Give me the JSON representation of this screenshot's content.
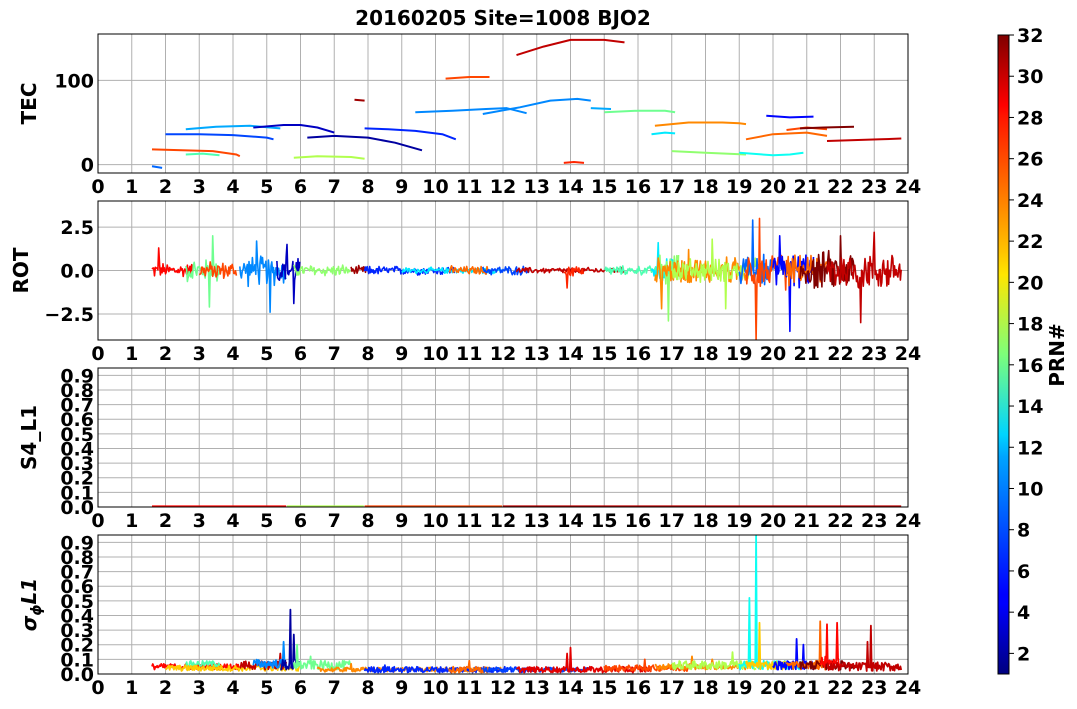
{
  "title": "20160205 Site=1008 BJO2",
  "colorbar": {
    "label": "PRN#",
    "range": [
      1,
      32
    ],
    "ticks": [
      2,
      4,
      6,
      8,
      10,
      12,
      14,
      16,
      18,
      20,
      22,
      24,
      26,
      28,
      30,
      32
    ],
    "colormap": "jet"
  },
  "chart_data": [
    {
      "type": "line",
      "panel": "TEC",
      "ylabel": "TEC",
      "xlim": [
        0,
        24
      ],
      "ylim": [
        -10,
        155
      ],
      "xticks": [
        0,
        1,
        2,
        3,
        4,
        5,
        6,
        7,
        8,
        9,
        10,
        11,
        12,
        13,
        14,
        15,
        16,
        17,
        18,
        19,
        20,
        21,
        22,
        23,
        24
      ],
      "yticks": [
        0,
        100
      ],
      "grid": true,
      "series": [
        {
          "prn": 26,
          "x": [
            1.6,
            2.5,
            3.4,
            4.1,
            4.2
          ],
          "y": [
            18,
            17,
            16,
            12,
            10
          ]
        },
        {
          "prn": 8,
          "x": [
            1.6,
            1.9
          ],
          "y": [
            -2,
            -4
          ]
        },
        {
          "prn": 15,
          "x": [
            2.6,
            3.1,
            3.6
          ],
          "y": [
            12,
            13,
            11
          ]
        },
        {
          "prn": 7,
          "x": [
            2.0,
            3.0,
            4.0,
            5.0,
            5.2
          ],
          "y": [
            36,
            36,
            35,
            32,
            30
          ]
        },
        {
          "prn": 10,
          "x": [
            2.6,
            3.5,
            4.5,
            5.4
          ],
          "y": [
            42,
            45,
            46,
            43
          ]
        },
        {
          "prn": 3,
          "x": [
            4.6,
            5.5,
            6.0,
            6.5,
            7.0
          ],
          "y": [
            44,
            47,
            47,
            44,
            38
          ]
        },
        {
          "prn": 18,
          "x": [
            5.8,
            6.5,
            7.5,
            7.9
          ],
          "y": [
            8,
            10,
            9,
            7
          ]
        },
        {
          "prn": 2,
          "x": [
            6.2,
            7.0,
            8.0,
            8.8,
            9.6
          ],
          "y": [
            32,
            34,
            32,
            26,
            17
          ]
        },
        {
          "prn": 31,
          "x": [
            7.6,
            7.9
          ],
          "y": [
            77,
            76
          ]
        },
        {
          "prn": 6,
          "x": [
            7.9,
            8.6,
            9.4,
            10.2,
            10.6
          ],
          "y": [
            43,
            42,
            40,
            36,
            30
          ]
        },
        {
          "prn": 9,
          "x": [
            9.4,
            10.5,
            11.5,
            12.1,
            12.7
          ],
          "y": [
            62,
            64,
            66,
            67,
            61
          ]
        },
        {
          "prn": 26,
          "x": [
            10.3,
            11.0,
            11.6
          ],
          "y": [
            102,
            104,
            104
          ]
        },
        {
          "prn": 9,
          "x": [
            11.4,
            12.5,
            13.4,
            14.2,
            14.6
          ],
          "y": [
            60,
            68,
            76,
            78,
            76
          ]
        },
        {
          "prn": 30,
          "x": [
            12.4,
            13.2,
            14.0,
            15.0,
            15.6
          ],
          "y": [
            130,
            140,
            148,
            148,
            145
          ]
        },
        {
          "prn": 27,
          "x": [
            13.8,
            14.1,
            14.4
          ],
          "y": [
            2,
            3,
            2
          ]
        },
        {
          "prn": 10,
          "x": [
            14.6,
            15.2
          ],
          "y": [
            67,
            66
          ]
        },
        {
          "prn": 16,
          "x": [
            15.0,
            16.0,
            16.8,
            17.1
          ],
          "y": [
            62,
            64,
            64,
            62
          ]
        },
        {
          "prn": 12,
          "x": [
            16.4,
            16.8,
            17.1
          ],
          "y": [
            36,
            38,
            37
          ]
        },
        {
          "prn": 24,
          "x": [
            16.5,
            17.5,
            18.5,
            19.0,
            19.2
          ],
          "y": [
            46,
            50,
            50,
            49,
            48
          ]
        },
        {
          "prn": 17,
          "x": [
            17.0,
            18.0,
            19.2
          ],
          "y": [
            16,
            14,
            12
          ]
        },
        {
          "prn": 13,
          "x": [
            19.0,
            20.0,
            20.5,
            20.9
          ],
          "y": [
            14,
            11,
            12,
            14
          ]
        },
        {
          "prn": 25,
          "x": [
            19.2,
            20.0,
            21.0,
            21.6
          ],
          "y": [
            30,
            36,
            38,
            34
          ]
        },
        {
          "prn": 5,
          "x": [
            19.8,
            20.5,
            21.2
          ],
          "y": [
            58,
            56,
            57
          ]
        },
        {
          "prn": 26,
          "x": [
            20.4,
            21.0,
            21.6
          ],
          "y": [
            41,
            44,
            42
          ]
        },
        {
          "prn": 32,
          "x": [
            20.8,
            21.5,
            22.4
          ],
          "y": [
            43,
            44,
            45
          ]
        },
        {
          "prn": 30,
          "x": [
            21.6,
            22.4,
            23.2,
            23.8
          ],
          "y": [
            28,
            29,
            30,
            31
          ]
        }
      ]
    },
    {
      "type": "line",
      "panel": "ROT",
      "ylabel": "ROT",
      "xlim": [
        0,
        24
      ],
      "ylim": [
        -4,
        4
      ],
      "xticks": [
        0,
        1,
        2,
        3,
        4,
        5,
        6,
        7,
        8,
        9,
        10,
        11,
        12,
        13,
        14,
        15,
        16,
        17,
        18,
        19,
        20,
        21,
        22,
        23,
        24
      ],
      "yticks": [
        -2.5,
        0.0,
        2.5
      ],
      "yticklabels": [
        "−2.5",
        "0.0",
        "2.5"
      ],
      "grid": true,
      "segments": [
        {
          "prn": 28,
          "x0": 1.6,
          "x1": 2.8,
          "amp": 0.5,
          "spikes": [
            [
              1.8,
              1.3
            ]
          ]
        },
        {
          "prn": 16,
          "x0": 2.6,
          "x1": 3.6,
          "amp": 0.8,
          "spikes": [
            [
              3.3,
              -2.1
            ],
            [
              3.4,
              2.0
            ]
          ]
        },
        {
          "prn": 26,
          "x0": 3.0,
          "x1": 4.1,
          "amp": 0.6,
          "spikes": []
        },
        {
          "prn": 9,
          "x0": 4.2,
          "x1": 5.6,
          "amp": 1.0,
          "spikes": [
            [
              5.1,
              -2.4
            ],
            [
              4.7,
              1.7
            ]
          ]
        },
        {
          "prn": 3,
          "x0": 5.3,
          "x1": 6.0,
          "amp": 1.1,
          "spikes": [
            [
              5.6,
              1.5
            ],
            [
              5.8,
              -1.9
            ]
          ]
        },
        {
          "prn": 17,
          "x0": 5.8,
          "x1": 7.5,
          "amp": 0.4,
          "spikes": []
        },
        {
          "prn": 31,
          "x0": 7.5,
          "x1": 8.0,
          "amp": 0.3,
          "spikes": []
        },
        {
          "prn": 6,
          "x0": 7.9,
          "x1": 10.6,
          "amp": 0.3,
          "spikes": []
        },
        {
          "prn": 12,
          "x0": 9.0,
          "x1": 12.0,
          "amp": 0.2,
          "spikes": []
        },
        {
          "prn": 25,
          "x0": 10.4,
          "x1": 11.6,
          "amp": 0.3,
          "spikes": []
        },
        {
          "prn": 7,
          "x0": 11.4,
          "x1": 12.8,
          "amp": 0.3,
          "spikes": []
        },
        {
          "prn": 30,
          "x0": 12.4,
          "x1": 15.6,
          "amp": 0.2,
          "spikes": []
        },
        {
          "prn": 27,
          "x0": 13.8,
          "x1": 14.4,
          "amp": 0.4,
          "spikes": [
            [
              13.9,
              -1.0
            ]
          ]
        },
        {
          "prn": 15,
          "x0": 15.0,
          "x1": 17.1,
          "amp": 0.3,
          "spikes": []
        },
        {
          "prn": 12,
          "x0": 16.4,
          "x1": 17.1,
          "amp": 0.8,
          "spikes": [
            [
              16.6,
              1.6
            ]
          ]
        },
        {
          "prn": 17,
          "x0": 16.6,
          "x1": 17.2,
          "amp": 1.2,
          "spikes": [
            [
              16.9,
              3.5
            ],
            [
              16.9,
              -2.9
            ]
          ]
        },
        {
          "prn": 24,
          "x0": 16.5,
          "x1": 19.2,
          "amp": 0.9,
          "spikes": [
            [
              16.7,
              -2.2
            ],
            [
              17.5,
              1.2
            ]
          ]
        },
        {
          "prn": 18,
          "x0": 17.0,
          "x1": 19.5,
          "amp": 0.8,
          "spikes": [
            [
              18.2,
              1.8
            ],
            [
              18.6,
              -2.2
            ]
          ]
        },
        {
          "prn": 8,
          "x0": 19.0,
          "x1": 20.0,
          "amp": 1.0,
          "spikes": [
            [
              19.4,
              2.9
            ]
          ]
        },
        {
          "prn": 26,
          "x0": 19.2,
          "x1": 20.4,
          "amp": 1.3,
          "spikes": [
            [
              19.5,
              -4.0
            ],
            [
              19.6,
              3.0
            ]
          ]
        },
        {
          "prn": 5,
          "x0": 20.0,
          "x1": 21.2,
          "amp": 1.2,
          "spikes": [
            [
              20.2,
              2.0
            ],
            [
              20.5,
              -3.5
            ]
          ]
        },
        {
          "prn": 25,
          "x0": 20.4,
          "x1": 21.6,
          "amp": 1.0,
          "spikes": []
        },
        {
          "prn": 32,
          "x0": 20.8,
          "x1": 22.4,
          "amp": 1.3,
          "spikes": [
            [
              22.0,
              2.0
            ]
          ]
        },
        {
          "prn": 30,
          "x0": 21.6,
          "x1": 23.8,
          "amp": 1.4,
          "spikes": [
            [
              22.6,
              -3.0
            ],
            [
              23.0,
              2.2
            ]
          ]
        }
      ]
    },
    {
      "type": "line",
      "panel": "S4_L1",
      "ylabel": "S4_L1",
      "xlim": [
        0,
        24
      ],
      "ylim": [
        0,
        0.95
      ],
      "xticks": [
        0,
        1,
        2,
        3,
        4,
        5,
        6,
        7,
        8,
        9,
        10,
        11,
        12,
        13,
        14,
        15,
        16,
        17,
        18,
        19,
        20,
        21,
        22,
        23,
        24
      ],
      "yticks": [
        0.0,
        0.1,
        0.2,
        0.3,
        0.4,
        0.5,
        0.6,
        0.7,
        0.8,
        0.9
      ],
      "grid": true,
      "segments": [
        {
          "prn": 28,
          "x0": 1.6,
          "x1": 5.6,
          "level": 0.005
        },
        {
          "prn": 18,
          "x0": 5.6,
          "x1": 7.9,
          "level": 0.005
        },
        {
          "prn": 26,
          "x0": 7.9,
          "x1": 12.0,
          "level": 0.005
        },
        {
          "prn": 30,
          "x0": 12.0,
          "x1": 23.8,
          "level": 0.005
        }
      ]
    },
    {
      "type": "line",
      "panel": "sigma_phi_L1",
      "ylabel": "σϕL1",
      "xlim": [
        0,
        24
      ],
      "ylim": [
        0,
        0.95
      ],
      "xticks": [
        0,
        1,
        2,
        3,
        4,
        5,
        6,
        7,
        8,
        9,
        10,
        11,
        12,
        13,
        14,
        15,
        16,
        17,
        18,
        19,
        20,
        21,
        22,
        23,
        24
      ],
      "yticks": [
        0.0,
        0.1,
        0.2,
        0.3,
        0.4,
        0.5,
        0.6,
        0.7,
        0.8,
        0.9
      ],
      "grid": true,
      "segments": [
        {
          "prn": 28,
          "x0": 1.6,
          "x1": 4.2,
          "base": 0.05,
          "amp": 0.02,
          "spikes": []
        },
        {
          "prn": 15,
          "x0": 2.6,
          "x1": 3.6,
          "base": 0.07,
          "amp": 0.02,
          "spikes": []
        },
        {
          "prn": 22,
          "x0": 2.0,
          "x1": 6.0,
          "base": 0.04,
          "amp": 0.02,
          "spikes": []
        },
        {
          "prn": 30,
          "x0": 4.2,
          "x1": 5.6,
          "base": 0.06,
          "amp": 0.03,
          "spikes": [
            [
              5.4,
              0.14
            ]
          ]
        },
        {
          "prn": 9,
          "x0": 4.6,
          "x1": 5.6,
          "base": 0.07,
          "amp": 0.03,
          "spikes": [
            [
              5.5,
              0.22
            ]
          ]
        },
        {
          "prn": 2,
          "x0": 5.4,
          "x1": 6.0,
          "base": 0.06,
          "amp": 0.04,
          "spikes": [
            [
              5.7,
              0.44
            ],
            [
              5.8,
              0.27
            ]
          ]
        },
        {
          "prn": 16,
          "x0": 5.8,
          "x1": 7.5,
          "base": 0.06,
          "amp": 0.03,
          "spikes": [
            [
              5.9,
              0.2
            ],
            [
              6.3,
              0.12
            ]
          ]
        },
        {
          "prn": 24,
          "x0": 6.5,
          "x1": 12.0,
          "base": 0.03,
          "amp": 0.015,
          "spikes": [
            [
              7.5,
              0.07
            ]
          ]
        },
        {
          "prn": 6,
          "x0": 7.9,
          "x1": 12.8,
          "base": 0.03,
          "amp": 0.02,
          "spikes": [
            [
              8.5,
              0.06
            ]
          ]
        },
        {
          "prn": 25,
          "x0": 10.4,
          "x1": 11.6,
          "base": 0.03,
          "amp": 0.02,
          "spikes": [
            [
              11.0,
              0.09
            ]
          ]
        },
        {
          "prn": 7,
          "x0": 11.4,
          "x1": 14.6,
          "base": 0.03,
          "amp": 0.015,
          "spikes": []
        },
        {
          "prn": 29,
          "x0": 12.4,
          "x1": 16.4,
          "base": 0.03,
          "amp": 0.02,
          "spikes": [
            [
              14.0,
              0.18
            ],
            [
              13.9,
              0.14
            ]
          ]
        },
        {
          "prn": 26,
          "x0": 15.0,
          "x1": 17.5,
          "base": 0.04,
          "amp": 0.02,
          "spikes": [
            [
              16.2,
              0.1
            ]
          ]
        },
        {
          "prn": 24,
          "x0": 16.5,
          "x1": 19.2,
          "base": 0.05,
          "amp": 0.02,
          "spikes": [
            [
              17.6,
              0.12
            ],
            [
              18.2,
              0.1
            ]
          ]
        },
        {
          "prn": 18,
          "x0": 17.0,
          "x1": 19.5,
          "base": 0.06,
          "amp": 0.03,
          "spikes": [
            [
              18.8,
              0.15
            ]
          ]
        },
        {
          "prn": 13,
          "x0": 19.0,
          "x1": 20.9,
          "base": 0.06,
          "amp": 0.03,
          "spikes": [
            [
              19.5,
              0.95
            ],
            [
              19.3,
              0.52
            ]
          ]
        },
        {
          "prn": 22,
          "x0": 19.2,
          "x1": 20.4,
          "base": 0.06,
          "amp": 0.03,
          "spikes": [
            [
              19.6,
              0.35
            ]
          ]
        },
        {
          "prn": 5,
          "x0": 20.0,
          "x1": 21.2,
          "base": 0.06,
          "amp": 0.03,
          "spikes": [
            [
              20.7,
              0.24
            ],
            [
              20.9,
              0.2
            ]
          ]
        },
        {
          "prn": 25,
          "x0": 20.4,
          "x1": 21.6,
          "base": 0.06,
          "amp": 0.03,
          "spikes": [
            [
              21.4,
              0.36
            ]
          ]
        },
        {
          "prn": 32,
          "x0": 20.8,
          "x1": 22.4,
          "base": 0.06,
          "amp": 0.03,
          "spikes": []
        },
        {
          "prn": 28,
          "x0": 21.4,
          "x1": 22.0,
          "base": 0.08,
          "amp": 0.04,
          "spikes": [
            [
              21.6,
              0.34
            ],
            [
              21.9,
              0.35
            ]
          ]
        },
        {
          "prn": 30,
          "x0": 21.6,
          "x1": 23.8,
          "base": 0.05,
          "amp": 0.03,
          "spikes": [
            [
              22.9,
              0.33
            ],
            [
              22.8,
              0.22
            ]
          ]
        }
      ]
    }
  ]
}
